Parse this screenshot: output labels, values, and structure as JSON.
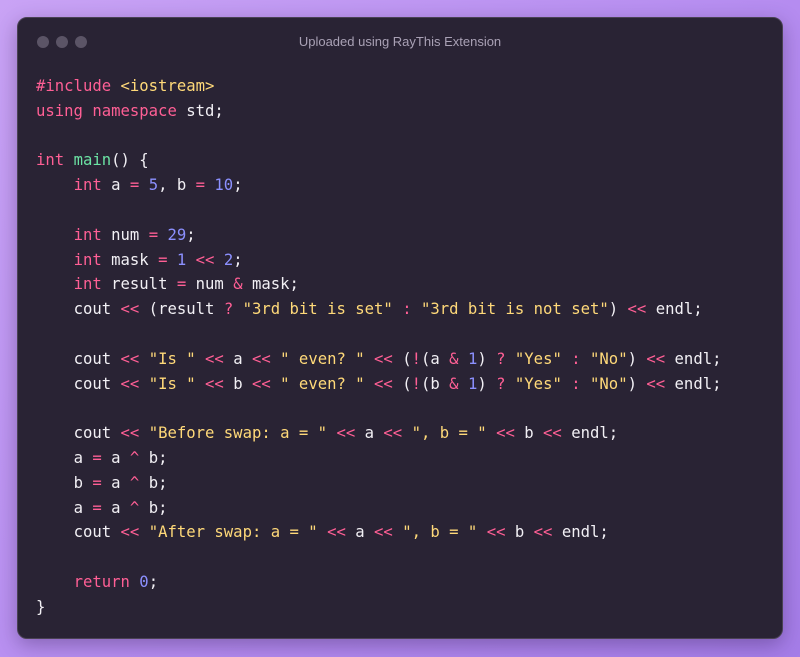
{
  "window": {
    "title": "Uploaded using RayThis Extension",
    "dots": [
      "window-dot-1",
      "window-dot-2",
      "window-dot-3"
    ]
  },
  "colors": {
    "keyword": "#ff5f95",
    "function": "#6be3a4",
    "string": "#ffd979",
    "number": "#8c90ff",
    "identifier": "#f2f0f5",
    "background": "#292334"
  },
  "code": {
    "language": "cpp",
    "lines": [
      [
        [
          "kw",
          "#include"
        ],
        [
          "pun",
          " "
        ],
        [
          "str",
          "<iostream>"
        ]
      ],
      [
        [
          "kw",
          "using"
        ],
        [
          "pun",
          " "
        ],
        [
          "kw",
          "namespace"
        ],
        [
          "pun",
          " "
        ],
        [
          "id",
          "std"
        ],
        [
          "pun",
          ";"
        ]
      ],
      [],
      [
        [
          "type",
          "int"
        ],
        [
          "pun",
          " "
        ],
        [
          "fn",
          "main"
        ],
        [
          "pun",
          "() {"
        ]
      ],
      [
        [
          "pun",
          "    "
        ],
        [
          "type",
          "int"
        ],
        [
          "pun",
          " "
        ],
        [
          "id",
          "a"
        ],
        [
          "pun",
          " "
        ],
        [
          "op",
          "="
        ],
        [
          "pun",
          " "
        ],
        [
          "num",
          "5"
        ],
        [
          "pun",
          ", "
        ],
        [
          "id",
          "b"
        ],
        [
          "pun",
          " "
        ],
        [
          "op",
          "="
        ],
        [
          "pun",
          " "
        ],
        [
          "num",
          "10"
        ],
        [
          "pun",
          ";"
        ]
      ],
      [],
      [
        [
          "pun",
          "    "
        ],
        [
          "type",
          "int"
        ],
        [
          "pun",
          " "
        ],
        [
          "id",
          "num"
        ],
        [
          "pun",
          " "
        ],
        [
          "op",
          "="
        ],
        [
          "pun",
          " "
        ],
        [
          "num",
          "29"
        ],
        [
          "pun",
          ";"
        ]
      ],
      [
        [
          "pun",
          "    "
        ],
        [
          "type",
          "int"
        ],
        [
          "pun",
          " "
        ],
        [
          "id",
          "mask"
        ],
        [
          "pun",
          " "
        ],
        [
          "op",
          "="
        ],
        [
          "pun",
          " "
        ],
        [
          "num",
          "1"
        ],
        [
          "pun",
          " "
        ],
        [
          "op",
          "<<"
        ],
        [
          "pun",
          " "
        ],
        [
          "num",
          "2"
        ],
        [
          "pun",
          ";"
        ]
      ],
      [
        [
          "pun",
          "    "
        ],
        [
          "type",
          "int"
        ],
        [
          "pun",
          " "
        ],
        [
          "id",
          "result"
        ],
        [
          "pun",
          " "
        ],
        [
          "op",
          "="
        ],
        [
          "pun",
          " "
        ],
        [
          "id",
          "num"
        ],
        [
          "pun",
          " "
        ],
        [
          "op",
          "&"
        ],
        [
          "pun",
          " "
        ],
        [
          "id",
          "mask"
        ],
        [
          "pun",
          ";"
        ]
      ],
      [
        [
          "pun",
          "    "
        ],
        [
          "id",
          "cout"
        ],
        [
          "pun",
          " "
        ],
        [
          "op",
          "<<"
        ],
        [
          "pun",
          " ("
        ],
        [
          "id",
          "result"
        ],
        [
          "pun",
          " "
        ],
        [
          "op",
          "?"
        ],
        [
          "pun",
          " "
        ],
        [
          "str",
          "\"3rd bit is set\""
        ],
        [
          "pun",
          " "
        ],
        [
          "op",
          ":"
        ],
        [
          "pun",
          " "
        ],
        [
          "str",
          "\"3rd bit is not set\""
        ],
        [
          "pun",
          ") "
        ],
        [
          "op",
          "<<"
        ],
        [
          "pun",
          " "
        ],
        [
          "id",
          "endl"
        ],
        [
          "pun",
          ";"
        ]
      ],
      [],
      [
        [
          "pun",
          "    "
        ],
        [
          "id",
          "cout"
        ],
        [
          "pun",
          " "
        ],
        [
          "op",
          "<<"
        ],
        [
          "pun",
          " "
        ],
        [
          "str",
          "\"Is \""
        ],
        [
          "pun",
          " "
        ],
        [
          "op",
          "<<"
        ],
        [
          "pun",
          " "
        ],
        [
          "id",
          "a"
        ],
        [
          "pun",
          " "
        ],
        [
          "op",
          "<<"
        ],
        [
          "pun",
          " "
        ],
        [
          "str",
          "\" even? \""
        ],
        [
          "pun",
          " "
        ],
        [
          "op",
          "<<"
        ],
        [
          "pun",
          " ("
        ],
        [
          "op",
          "!"
        ],
        [
          "pun",
          "("
        ],
        [
          "id",
          "a"
        ],
        [
          "pun",
          " "
        ],
        [
          "op",
          "&"
        ],
        [
          "pun",
          " "
        ],
        [
          "num",
          "1"
        ],
        [
          "pun",
          ") "
        ],
        [
          "op",
          "?"
        ],
        [
          "pun",
          " "
        ],
        [
          "str",
          "\"Yes\""
        ],
        [
          "pun",
          " "
        ],
        [
          "op",
          ":"
        ],
        [
          "pun",
          " "
        ],
        [
          "str",
          "\"No\""
        ],
        [
          "pun",
          ") "
        ],
        [
          "op",
          "<<"
        ],
        [
          "pun",
          " "
        ],
        [
          "id",
          "endl"
        ],
        [
          "pun",
          ";"
        ]
      ],
      [
        [
          "pun",
          "    "
        ],
        [
          "id",
          "cout"
        ],
        [
          "pun",
          " "
        ],
        [
          "op",
          "<<"
        ],
        [
          "pun",
          " "
        ],
        [
          "str",
          "\"Is \""
        ],
        [
          "pun",
          " "
        ],
        [
          "op",
          "<<"
        ],
        [
          "pun",
          " "
        ],
        [
          "id",
          "b"
        ],
        [
          "pun",
          " "
        ],
        [
          "op",
          "<<"
        ],
        [
          "pun",
          " "
        ],
        [
          "str",
          "\" even? \""
        ],
        [
          "pun",
          " "
        ],
        [
          "op",
          "<<"
        ],
        [
          "pun",
          " ("
        ],
        [
          "op",
          "!"
        ],
        [
          "pun",
          "("
        ],
        [
          "id",
          "b"
        ],
        [
          "pun",
          " "
        ],
        [
          "op",
          "&"
        ],
        [
          "pun",
          " "
        ],
        [
          "num",
          "1"
        ],
        [
          "pun",
          ") "
        ],
        [
          "op",
          "?"
        ],
        [
          "pun",
          " "
        ],
        [
          "str",
          "\"Yes\""
        ],
        [
          "pun",
          " "
        ],
        [
          "op",
          ":"
        ],
        [
          "pun",
          " "
        ],
        [
          "str",
          "\"No\""
        ],
        [
          "pun",
          ") "
        ],
        [
          "op",
          "<<"
        ],
        [
          "pun",
          " "
        ],
        [
          "id",
          "endl"
        ],
        [
          "pun",
          ";"
        ]
      ],
      [],
      [
        [
          "pun",
          "    "
        ],
        [
          "id",
          "cout"
        ],
        [
          "pun",
          " "
        ],
        [
          "op",
          "<<"
        ],
        [
          "pun",
          " "
        ],
        [
          "str",
          "\"Before swap: a = \""
        ],
        [
          "pun",
          " "
        ],
        [
          "op",
          "<<"
        ],
        [
          "pun",
          " "
        ],
        [
          "id",
          "a"
        ],
        [
          "pun",
          " "
        ],
        [
          "op",
          "<<"
        ],
        [
          "pun",
          " "
        ],
        [
          "str",
          "\", b = \""
        ],
        [
          "pun",
          " "
        ],
        [
          "op",
          "<<"
        ],
        [
          "pun",
          " "
        ],
        [
          "id",
          "b"
        ],
        [
          "pun",
          " "
        ],
        [
          "op",
          "<<"
        ],
        [
          "pun",
          " "
        ],
        [
          "id",
          "endl"
        ],
        [
          "pun",
          ";"
        ]
      ],
      [
        [
          "pun",
          "    "
        ],
        [
          "id",
          "a"
        ],
        [
          "pun",
          " "
        ],
        [
          "op",
          "="
        ],
        [
          "pun",
          " "
        ],
        [
          "id",
          "a"
        ],
        [
          "pun",
          " "
        ],
        [
          "op",
          "^"
        ],
        [
          "pun",
          " "
        ],
        [
          "id",
          "b"
        ],
        [
          "pun",
          ";"
        ]
      ],
      [
        [
          "pun",
          "    "
        ],
        [
          "id",
          "b"
        ],
        [
          "pun",
          " "
        ],
        [
          "op",
          "="
        ],
        [
          "pun",
          " "
        ],
        [
          "id",
          "a"
        ],
        [
          "pun",
          " "
        ],
        [
          "op",
          "^"
        ],
        [
          "pun",
          " "
        ],
        [
          "id",
          "b"
        ],
        [
          "pun",
          ";"
        ]
      ],
      [
        [
          "pun",
          "    "
        ],
        [
          "id",
          "a"
        ],
        [
          "pun",
          " "
        ],
        [
          "op",
          "="
        ],
        [
          "pun",
          " "
        ],
        [
          "id",
          "a"
        ],
        [
          "pun",
          " "
        ],
        [
          "op",
          "^"
        ],
        [
          "pun",
          " "
        ],
        [
          "id",
          "b"
        ],
        [
          "pun",
          ";"
        ]
      ],
      [
        [
          "pun",
          "    "
        ],
        [
          "id",
          "cout"
        ],
        [
          "pun",
          " "
        ],
        [
          "op",
          "<<"
        ],
        [
          "pun",
          " "
        ],
        [
          "str",
          "\"After swap: a = \""
        ],
        [
          "pun",
          " "
        ],
        [
          "op",
          "<<"
        ],
        [
          "pun",
          " "
        ],
        [
          "id",
          "a"
        ],
        [
          "pun",
          " "
        ],
        [
          "op",
          "<<"
        ],
        [
          "pun",
          " "
        ],
        [
          "str",
          "\", b = \""
        ],
        [
          "pun",
          " "
        ],
        [
          "op",
          "<<"
        ],
        [
          "pun",
          " "
        ],
        [
          "id",
          "b"
        ],
        [
          "pun",
          " "
        ],
        [
          "op",
          "<<"
        ],
        [
          "pun",
          " "
        ],
        [
          "id",
          "endl"
        ],
        [
          "pun",
          ";"
        ]
      ],
      [],
      [
        [
          "pun",
          "    "
        ],
        [
          "kw",
          "return"
        ],
        [
          "pun",
          " "
        ],
        [
          "num",
          "0"
        ],
        [
          "pun",
          ";"
        ]
      ],
      [
        [
          "pun",
          "}"
        ]
      ]
    ]
  }
}
